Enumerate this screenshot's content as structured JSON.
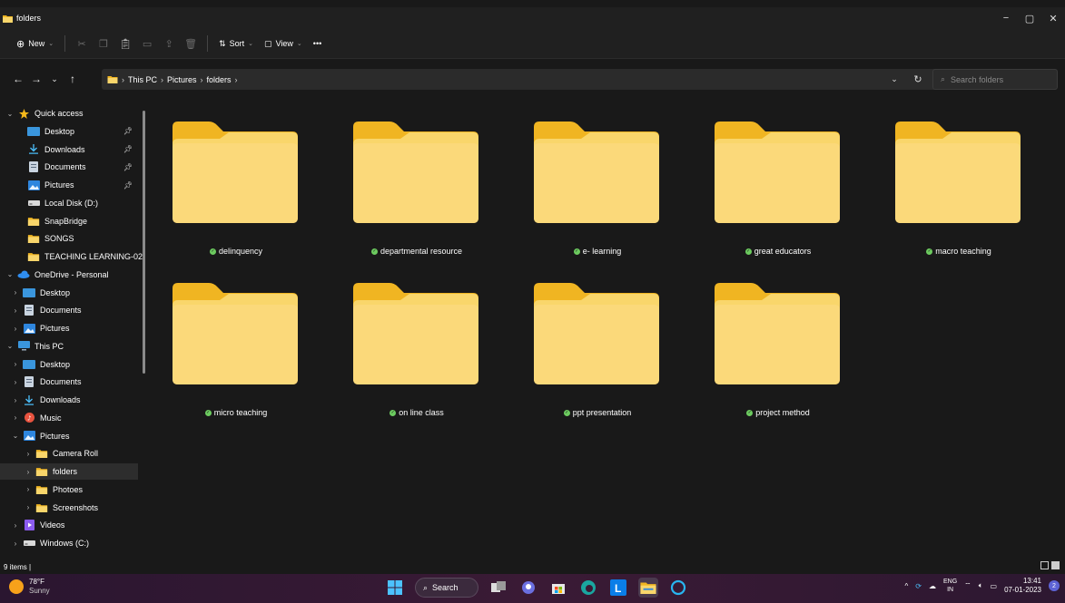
{
  "window": {
    "title": "folders",
    "controls": {
      "minimize": "−",
      "maximize": "▢",
      "close": "✕"
    }
  },
  "command_bar": {
    "new_label": "New",
    "sort_label": "Sort",
    "view_label": "View",
    "more_label": "•••"
  },
  "address_bar": {
    "crumbs": [
      "This PC",
      "Pictures",
      "folders"
    ],
    "search_placeholder": "Search folders"
  },
  "sidebar": {
    "items": [
      {
        "label": "Quick access",
        "icon": "star-icon",
        "expander": "⌄"
      },
      {
        "label": "Desktop",
        "icon": "desktop-icon",
        "pinned": true
      },
      {
        "label": "Downloads",
        "icon": "download-icon",
        "pinned": true
      },
      {
        "label": "Documents",
        "icon": "document-icon",
        "pinned": true
      },
      {
        "label": "Pictures",
        "icon": "pictures-icon",
        "pinned": true
      },
      {
        "label": "Local Disk (D:)",
        "icon": "drive-icon"
      },
      {
        "label": "SnapBridge",
        "icon": "folder-icon"
      },
      {
        "label": "SONGS",
        "icon": "folder-icon"
      },
      {
        "label": "TEACHING LEARNING-02",
        "icon": "folder-icon"
      },
      {
        "label": "OneDrive - Personal",
        "icon": "cloud-icon",
        "expander": "⌄"
      },
      {
        "label": "Desktop",
        "icon": "desktop-icon",
        "expander": "›"
      },
      {
        "label": "Documents",
        "icon": "document-icon",
        "expander": "›"
      },
      {
        "label": "Pictures",
        "icon": "pictures-icon",
        "expander": "›"
      },
      {
        "label": "This PC",
        "icon": "pc-icon",
        "expander": "⌄"
      },
      {
        "label": "Desktop",
        "icon": "desktop-icon",
        "expander": "›"
      },
      {
        "label": "Documents",
        "icon": "document-icon",
        "expander": "›"
      },
      {
        "label": "Downloads",
        "icon": "download-icon",
        "expander": "›"
      },
      {
        "label": "Music",
        "icon": "music-icon",
        "expander": "›"
      },
      {
        "label": "Pictures",
        "icon": "pictures-icon",
        "expander": "⌄"
      },
      {
        "label": "Camera Roll",
        "icon": "folder-icon",
        "expander": "›"
      },
      {
        "label": "folders",
        "icon": "folder-icon",
        "expander": "›",
        "selected": true
      },
      {
        "label": "Photoes",
        "icon": "folder-icon",
        "expander": "›"
      },
      {
        "label": "Screenshots",
        "icon": "folder-icon",
        "expander": "›"
      },
      {
        "label": "Videos",
        "icon": "video-icon",
        "expander": "›"
      },
      {
        "label": "Windows (C:)",
        "icon": "drive-icon",
        "expander": "›"
      }
    ]
  },
  "folders": [
    "delinquency",
    "departmental resource",
    "e- learning",
    "great educators",
    "macro teaching",
    "micro teaching",
    "on line class",
    "ppt presentation",
    "project method"
  ],
  "status_bar": {
    "item_count": "9 items  |"
  },
  "taskbar": {
    "weather_temp": "78°F",
    "weather_desc": "Sunny",
    "search_label": "Search",
    "lang_top": "ENG",
    "lang_bottom": "IN",
    "time": "13:41",
    "date": "07-01-2023",
    "notification_count": "2"
  },
  "colors": {
    "folder_body": "#f9d66b",
    "folder_tab": "#f0b522",
    "sync_green": "#6ccb5f",
    "background": "#191919"
  }
}
